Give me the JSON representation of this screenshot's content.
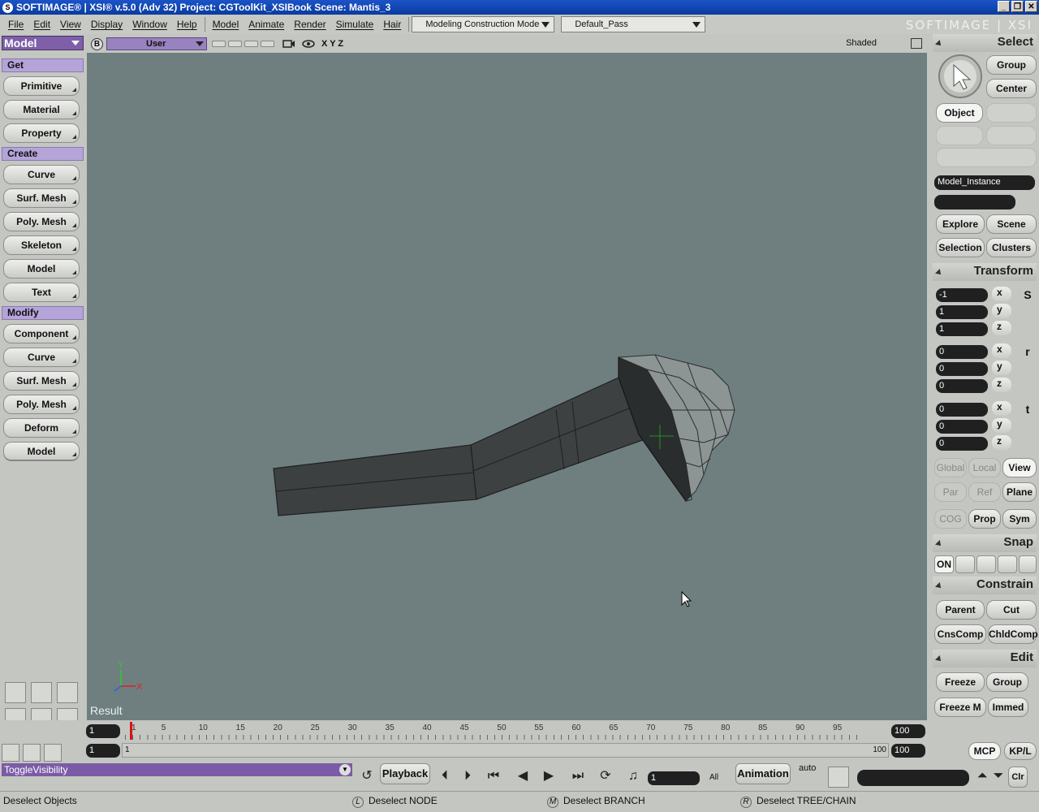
{
  "window": {
    "title": "SOFTIMAGE® | XSI® v.5.0 (Adv 32) Project: CGToolKit_XSIBook    Scene: Mantis_3",
    "logo": "S",
    "min": "_",
    "max": "❐",
    "close": "✕"
  },
  "menus": [
    "File",
    "Edit",
    "View",
    "Display",
    "Window",
    "Help",
    "Model",
    "Animate",
    "Render",
    "Simulate",
    "Hair"
  ],
  "mode_dropdown": "Modeling Construction Mode",
  "pass_dropdown": "Default_Pass",
  "brand": "SOFTIMAGE | XSI",
  "left": {
    "module": "Model",
    "get_label": "Get",
    "get": [
      "Primitive",
      "Material",
      "Property"
    ],
    "create_label": "Create",
    "create": [
      "Curve",
      "Surf. Mesh",
      "Poly. Mesh",
      "Skeleton",
      "Model",
      "Text"
    ],
    "modify_label": "Modify",
    "modify": [
      "Component",
      "Curve",
      "Surf. Mesh",
      "Poly. Mesh",
      "Deform",
      "Model"
    ]
  },
  "viewport": {
    "b": "B",
    "camera": "User",
    "axes": "X Y Z",
    "shading": "Shaded",
    "result": "Result",
    "axis_x": "X",
    "axis_y": "Y"
  },
  "right": {
    "select_label": "Select",
    "group": "Group",
    "center": "Center",
    "object": "Object",
    "model_instance": "Model_Instance",
    "explore": "Explore",
    "scene": "Scene",
    "selection": "Selection",
    "clusters": "Clusters",
    "transform_label": "Transform",
    "scale": [
      "-1",
      "1",
      "1"
    ],
    "rotate": [
      "0",
      "0",
      "0"
    ],
    "translate": [
      "0",
      "0",
      "0"
    ],
    "axes": [
      "x",
      "y",
      "z"
    ],
    "s": "S",
    "r": "r",
    "t": "t",
    "global": "Global",
    "local": "Local",
    "view": "View",
    "par": "Par",
    "ref": "Ref",
    "plane": "Plane",
    "cog": "COG",
    "prop": "Prop",
    "sym": "Sym",
    "snap_label": "Snap",
    "snap_on": "ON",
    "constrain_label": "Constrain",
    "parent": "Parent",
    "cut": "Cut",
    "cnscomp": "CnsComp",
    "chldcomp": "ChldComp",
    "edit_label": "Edit",
    "freeze": "Freeze",
    "group2": "Group",
    "freeze_m": "Freeze M",
    "immed": "Immed"
  },
  "timeline": {
    "start": "1",
    "end": "100",
    "range_start": "1",
    "range_end": "100",
    "range_start_label": "1",
    "range_end_label": "100",
    "labels": [
      "1",
      "5",
      "10",
      "15",
      "20",
      "25",
      "30",
      "35",
      "40",
      "45",
      "50",
      "55",
      "60",
      "65",
      "70",
      "75",
      "80",
      "85",
      "90",
      "95"
    ],
    "current_frame": 1
  },
  "bottom": {
    "command": "ToggleVisibility",
    "playback": "Playback",
    "frame": "1",
    "all": "All",
    "animation": "Animation",
    "auto": "auto",
    "clr": "Clr",
    "mcp": "MCP",
    "kpl": "KP/L"
  },
  "status": {
    "left": "Deselect Objects",
    "l_key": "L",
    "l_text": "Deselect NODE",
    "m_key": "M",
    "m_text": "Deselect BRANCH",
    "r_key": "R",
    "r_text": "Deselect TREE/CHAIN"
  },
  "colors": {
    "viewport_bg": "#6f7f7f",
    "accent_purple": "#7e5fa8",
    "section_lilac": "#b5a4d8"
  }
}
